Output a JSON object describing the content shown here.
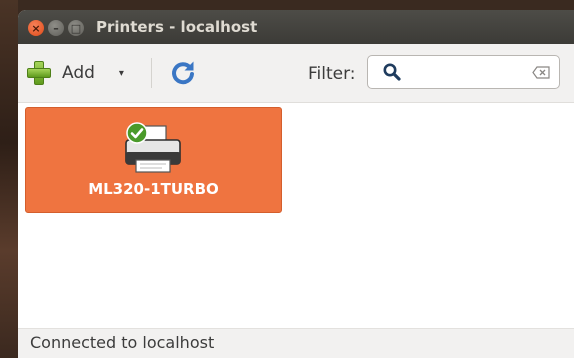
{
  "window": {
    "title": "Printers - localhost",
    "controls": {
      "close": "×",
      "minimize": "–",
      "maximize": "□"
    }
  },
  "toolbar": {
    "add_label": "Add",
    "add_dropdown_glyph": "▾",
    "filter_label": "Filter:",
    "filter": {
      "value": "",
      "placeholder": ""
    },
    "icons": [
      "plus-icon",
      "refresh-icon",
      "search-icon",
      "clear-icon"
    ]
  },
  "printers": [
    {
      "name": "ML320-1TURBO",
      "is_default": true,
      "selected": true
    }
  ],
  "status": {
    "text": "Connected to localhost"
  },
  "colors": {
    "selection": "#ef7440",
    "titlebar": "#3c3b37",
    "close_button": "#df4a17",
    "default_check": "#4a9a2a"
  }
}
